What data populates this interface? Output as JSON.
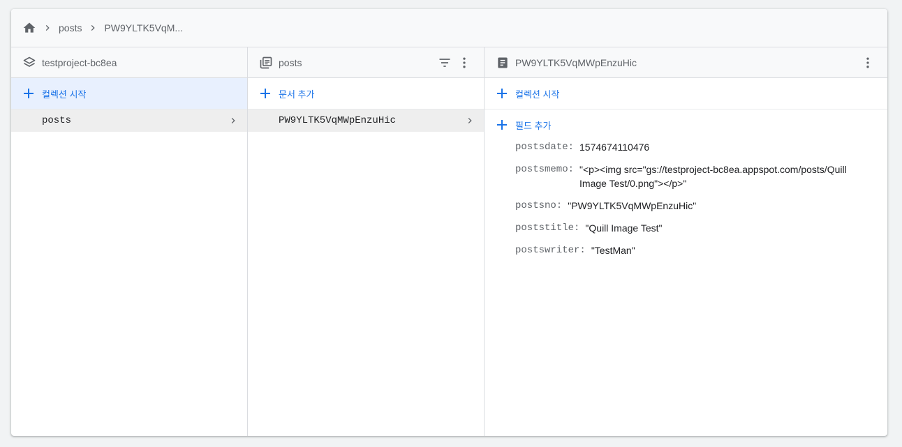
{
  "breadcrumb": {
    "home_icon": "home-icon",
    "items": [
      "posts",
      "PW9YLTK5VqM..."
    ]
  },
  "columns": {
    "root": {
      "title": "testproject-bc8ea",
      "icon": "database-layers-icon",
      "action_label": "컬렉션 시작",
      "items": [
        "posts"
      ]
    },
    "collection": {
      "title": "posts",
      "icon": "collection-icon",
      "action_label": "문서 추가",
      "items": [
        "PW9YLTK5VqMWpEnzuHic"
      ]
    },
    "document": {
      "title": "PW9YLTK5VqMWpEnzuHic",
      "icon": "document-icon",
      "action_label": "컬렉션 시작",
      "add_field_label": "필드 추가",
      "fields": [
        {
          "key": "postsdate:",
          "value": "1574674110476"
        },
        {
          "key": "postsmemo:",
          "value": "\"<p><img src=\"gs://testproject-bc8ea.appspot.com/posts/Quill Image Test/0.png\"></p>\""
        },
        {
          "key": "postsno:",
          "value": "\"PW9YLTK5VqMWpEnzuHic\""
        },
        {
          "key": "poststitle:",
          "value": "\"Quill Image Test\""
        },
        {
          "key": "postswriter:",
          "value": "\"TestMan\""
        }
      ]
    }
  },
  "colors": {
    "accent": "#1a73e8",
    "selected_bg": "#e8f0fe",
    "item_bg": "#eeeeee",
    "icon_gray": "#5f6368"
  }
}
